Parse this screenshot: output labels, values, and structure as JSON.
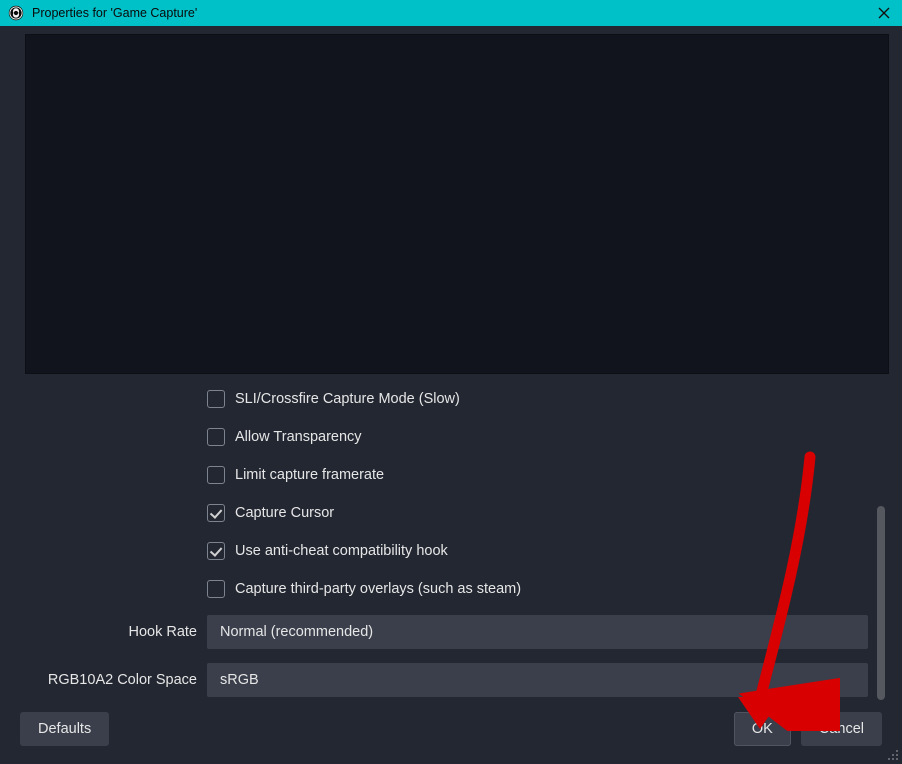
{
  "window": {
    "title": "Properties for 'Game Capture'"
  },
  "options": {
    "sli": {
      "label": "SLI/Crossfire Capture Mode (Slow)",
      "checked": false
    },
    "transparency": {
      "label": "Allow Transparency",
      "checked": false
    },
    "limitfps": {
      "label": "Limit capture framerate",
      "checked": false
    },
    "cursor": {
      "label": "Capture Cursor",
      "checked": true
    },
    "anticheat": {
      "label": "Use anti-cheat compatibility hook",
      "checked": true
    },
    "overlays": {
      "label": "Capture third-party overlays (such as steam)",
      "checked": false
    }
  },
  "dropdowns": {
    "hook_rate": {
      "label": "Hook Rate",
      "value": "Normal (recommended)"
    },
    "color_space": {
      "label": "RGB10A2 Color Space",
      "value": "sRGB"
    }
  },
  "buttons": {
    "defaults": "Defaults",
    "ok": "OK",
    "cancel": "Cancel"
  }
}
